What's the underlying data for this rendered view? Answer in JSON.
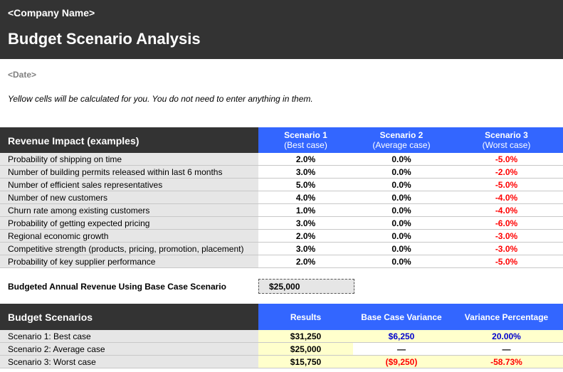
{
  "header": {
    "company": "<Company Name>",
    "title": "Budget Scenario Analysis"
  },
  "date": "<Date>",
  "note": "Yellow cells will be calculated for you. You do not need to enter anything in them.",
  "revenue_impact": {
    "heading": "Revenue Impact (examples)",
    "columns": [
      {
        "title": "Scenario 1",
        "subtitle": "(Best case)"
      },
      {
        "title": "Scenario 2",
        "subtitle": "(Average case)"
      },
      {
        "title": "Scenario 3",
        "subtitle": "(Worst case)"
      }
    ],
    "rows": [
      {
        "label": "Probability of shipping on time",
        "s1": "2.0%",
        "s2": "0.0%",
        "s3": "-5.0%"
      },
      {
        "label": "Number of building permits released within last 6 months",
        "s1": "3.0%",
        "s2": "0.0%",
        "s3": "-2.0%"
      },
      {
        "label": "Number of efficient sales representatives",
        "s1": "5.0%",
        "s2": "0.0%",
        "s3": "-5.0%"
      },
      {
        "label": "Number of new customers",
        "s1": "4.0%",
        "s2": "0.0%",
        "s3": "-4.0%"
      },
      {
        "label": "Churn rate among existing customers",
        "s1": "1.0%",
        "s2": "0.0%",
        "s3": "-4.0%"
      },
      {
        "label": "Probability of getting expected pricing",
        "s1": "3.0%",
        "s2": "0.0%",
        "s3": "-6.0%"
      },
      {
        "label": "Regional economic growth",
        "s1": "2.0%",
        "s2": "0.0%",
        "s3": "-3.0%"
      },
      {
        "label": "Competitive strength (products, pricing, promotion, placement)",
        "s1": "3.0%",
        "s2": "0.0%",
        "s3": "-3.0%"
      },
      {
        "label": "Probability of key supplier performance",
        "s1": "2.0%",
        "s2": "0.0%",
        "s3": "-5.0%"
      }
    ]
  },
  "base_revenue": {
    "label": "Budgeted Annual Revenue Using Base Case Scenario",
    "value": "$25,000"
  },
  "budget_scenarios": {
    "heading": "Budget Scenarios",
    "columns": [
      "Results",
      "Base Case Variance",
      "Variance Percentage"
    ],
    "rows": [
      {
        "label": "Scenario 1: Best case",
        "results": "$31,250",
        "variance": "$6,250",
        "percent": "20.00%"
      },
      {
        "label": "Scenario 2: Average case",
        "results": "$25,000",
        "variance": "—",
        "percent": "—"
      },
      {
        "label": "Scenario 3: Worst case",
        "results": "$15,750",
        "variance": "($9,250)",
        "percent": "-58.73%"
      }
    ]
  },
  "colors": {
    "header_dark": "#333333",
    "column_blue": "#3366ff",
    "calculated_yellow": "#ffffcc",
    "negative_red": "#ff0000",
    "positive_blue": "#0000cc"
  }
}
